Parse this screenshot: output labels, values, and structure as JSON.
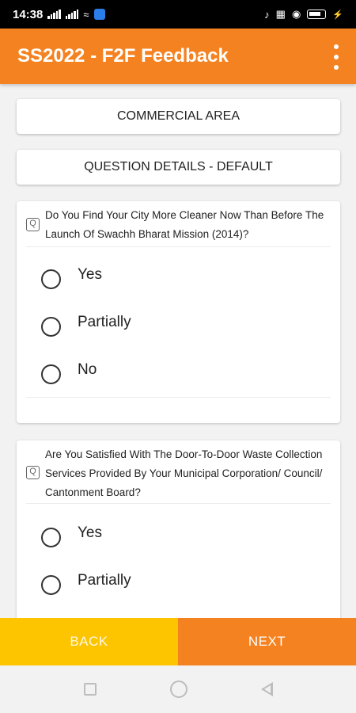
{
  "status_bar": {
    "time": "14:38",
    "network": "4G"
  },
  "app": {
    "title": "SS2022 - F2F Feedback",
    "colors": {
      "primary": "#f58220",
      "back_button": "#fdc500"
    }
  },
  "sections": {
    "area": "COMMERCIAL AREA",
    "question_details": "QUESTION DETAILS - DEFAULT"
  },
  "questions": [
    {
      "text": "Do You Find Your City More Cleaner Now Than Before The Launch Of Swachh Bharat Mission (2014)?",
      "options": [
        "Yes",
        "Partially",
        "No"
      ]
    },
    {
      "text": "Are You Satisfied With The Door-To-Door Waste Collection Services Provided By Your Municipal Corporation/ Council/ Cantonment Board?",
      "options": [
        "Yes",
        "Partially"
      ]
    }
  ],
  "footer": {
    "back_label": "BACK",
    "next_label": "NEXT"
  }
}
